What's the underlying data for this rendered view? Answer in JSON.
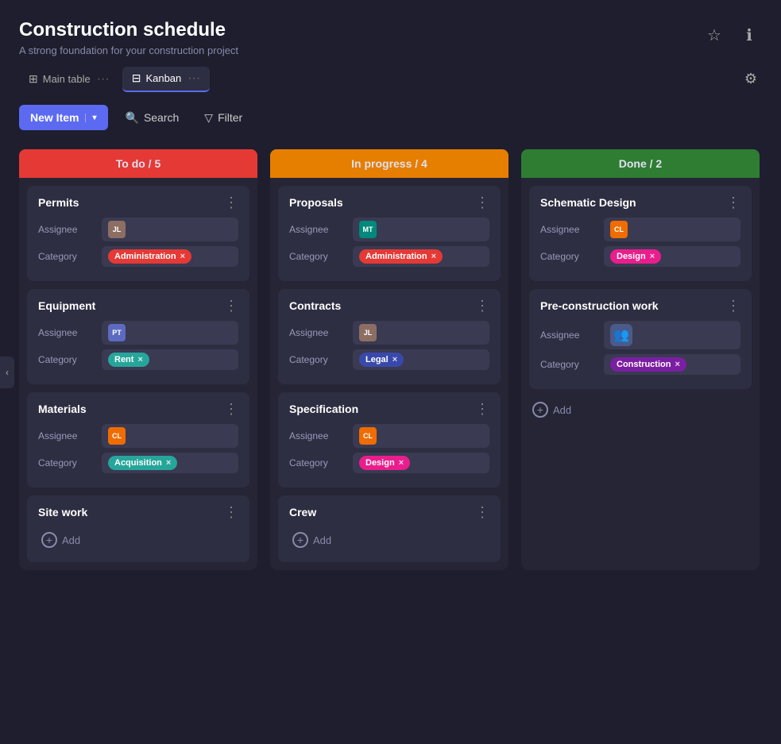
{
  "app": {
    "title": "Construction schedule",
    "subtitle": "A strong foundation for your construction project"
  },
  "header_icons": {
    "star": "☆",
    "info": "ℹ"
  },
  "tabs": [
    {
      "id": "main-table",
      "label": "Main table",
      "icon": "⊞",
      "active": false
    },
    {
      "id": "kanban",
      "label": "Kanban",
      "icon": "⊟",
      "active": true
    }
  ],
  "toolbar": {
    "new_item_label": "New Item",
    "search_label": "Search",
    "filter_label": "Filter"
  },
  "columns": [
    {
      "id": "todo",
      "header": "To do / 5",
      "color_class": "col-todo",
      "cards": [
        {
          "id": "permits",
          "title": "Permits",
          "assignee_initials": "JL",
          "assignee_color": "#8d6e63",
          "category": "Administration",
          "category_class": "tag-administration"
        },
        {
          "id": "equipment",
          "title": "Equipment",
          "assignee_initials": "PT",
          "assignee_color": "#5c6bc0",
          "category": "Rent",
          "category_class": "tag-rent"
        },
        {
          "id": "materials",
          "title": "Materials",
          "assignee_initials": "CL",
          "assignee_color": "#ef6c00",
          "category": "Acquisition",
          "category_class": "tag-acquisition"
        },
        {
          "id": "site-work",
          "title": "Site work",
          "show_add": true
        }
      ]
    },
    {
      "id": "inprogress",
      "header": "In progress / 4",
      "color_class": "col-inprogress",
      "cards": [
        {
          "id": "proposals",
          "title": "Proposals",
          "assignee_initials": "MT",
          "assignee_color": "#00897b",
          "category": "Administration",
          "category_class": "tag-administration"
        },
        {
          "id": "contracts",
          "title": "Contracts",
          "assignee_initials": "JL",
          "assignee_color": "#8d6e63",
          "category": "Legal",
          "category_class": "tag-legal"
        },
        {
          "id": "specification",
          "title": "Specification",
          "assignee_initials": "CL",
          "assignee_color": "#ef6c00",
          "category": "Design",
          "category_class": "tag-design"
        },
        {
          "id": "crew",
          "title": "Crew",
          "show_add": true
        }
      ]
    },
    {
      "id": "done",
      "header": "Done / 2",
      "color_class": "col-done",
      "cards": [
        {
          "id": "schematic-design",
          "title": "Schematic Design",
          "assignee_initials": "CL",
          "assignee_color": "#ef6c00",
          "category": "Design",
          "category_class": "tag-design"
        },
        {
          "id": "pre-construction",
          "title": "Pre-construction work",
          "assignee_group": true,
          "category": "Construction",
          "category_class": "tag-construction"
        }
      ],
      "show_add": true,
      "add_label": "Add"
    }
  ],
  "labels": {
    "assignee": "Assignee",
    "category": "Category",
    "add": "Add"
  }
}
